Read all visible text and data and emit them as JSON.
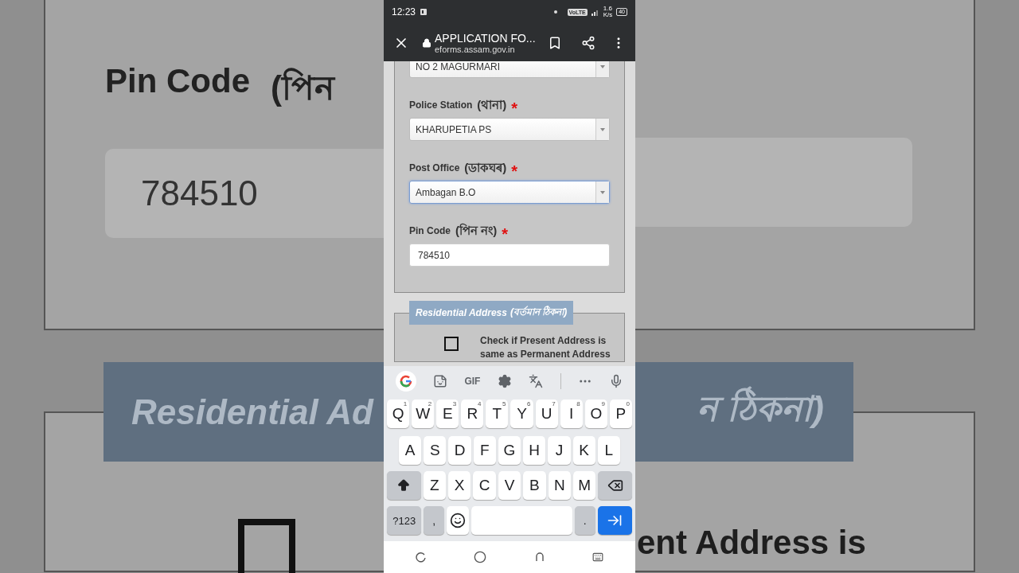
{
  "backdrop": {
    "left": {
      "heading": "Pin Code",
      "heading_local": "(পিন",
      "field_value": "784510",
      "band_text": "Residential Ad",
      "checkbox_checked": false
    },
    "right": {
      "band_text": "ন ঠিকনা)",
      "text": "ent Address is"
    }
  },
  "status_bar": {
    "time": "12:23",
    "network": "VoLTE",
    "speed_value": "1.6",
    "speed_unit": "K/s",
    "battery": "40"
  },
  "browser": {
    "title": "APPLICATION FO...",
    "url": "eforms.assam.gov.in"
  },
  "form": {
    "fields": [
      {
        "kind": "select",
        "value": "NO 2 MAGURMARI",
        "focused": false
      },
      {
        "kind": "select",
        "label": "Police Station",
        "label_local": "(থানা)",
        "required_mark": "*",
        "value": "KHARUPETIA PS",
        "focused": false
      },
      {
        "kind": "select",
        "label": "Post Office",
        "label_local": "(ডাকঘৰ)",
        "required_mark": "*",
        "value": "Ambagan B.O",
        "focused": true
      },
      {
        "kind": "text",
        "label": "Pin Code",
        "label_local": "(পিন নং)",
        "required_mark": "*",
        "value": "784510",
        "focused": false
      }
    ]
  },
  "residential": {
    "legend": "Residential Address",
    "legend_local": "(বৰ্তমান ঠিকনা)",
    "checkbox": {
      "lines": [
        "Check if Present Address is",
        "same as Permanent Address"
      ],
      "checked": false
    }
  },
  "keyboard": {
    "toolbar_gif": "GIF",
    "rows": [
      [
        {
          "kind": "letter",
          "label": "Q",
          "hint": "1"
        },
        {
          "kind": "letter",
          "label": "W",
          "hint": "2"
        },
        {
          "kind": "letter",
          "label": "E",
          "hint": "3"
        },
        {
          "kind": "letter",
          "label": "R",
          "hint": "4"
        },
        {
          "kind": "letter",
          "label": "T",
          "hint": "5"
        },
        {
          "kind": "letter",
          "label": "Y",
          "hint": "6"
        },
        {
          "kind": "letter",
          "label": "U",
          "hint": "7"
        },
        {
          "kind": "letter",
          "label": "I",
          "hint": "8"
        },
        {
          "kind": "letter",
          "label": "O",
          "hint": "9"
        },
        {
          "kind": "letter",
          "label": "P",
          "hint": "0"
        }
      ],
      [
        {
          "kind": "letter",
          "label": "A"
        },
        {
          "kind": "letter",
          "label": "S"
        },
        {
          "kind": "letter",
          "label": "D"
        },
        {
          "kind": "letter",
          "label": "F"
        },
        {
          "kind": "letter",
          "label": "G"
        },
        {
          "kind": "letter",
          "label": "H"
        },
        {
          "kind": "letter",
          "label": "J"
        },
        {
          "kind": "letter",
          "label": "K"
        },
        {
          "kind": "letter",
          "label": "L"
        }
      ],
      [
        {
          "kind": "shift"
        },
        {
          "kind": "letter",
          "label": "Z"
        },
        {
          "kind": "letter",
          "label": "X"
        },
        {
          "kind": "letter",
          "label": "C"
        },
        {
          "kind": "letter",
          "label": "V"
        },
        {
          "kind": "letter",
          "label": "B"
        },
        {
          "kind": "letter",
          "label": "N"
        },
        {
          "kind": "letter",
          "label": "M"
        },
        {
          "kind": "backspace"
        }
      ]
    ],
    "bottom_keys": {
      "symbols": "?123",
      "comma": ",",
      "period": "."
    }
  }
}
